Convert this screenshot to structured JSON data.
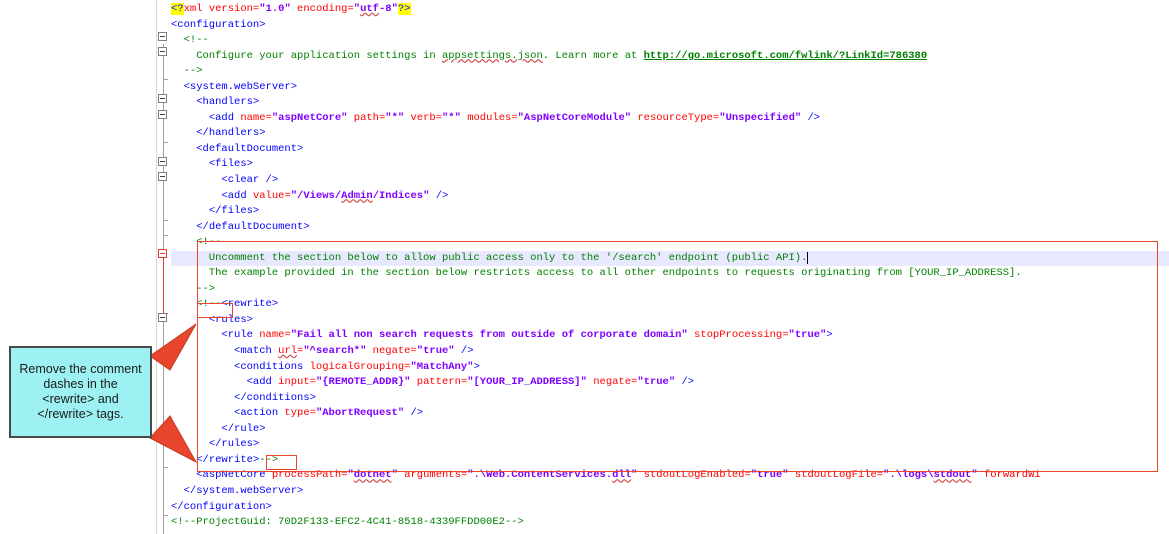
{
  "editor": {
    "lines": {
      "l1_pi_open": "<?",
      "l1_pi_name": "xml",
      "l1_attr_version": " version=",
      "l1_val_version": "\"1.0\"",
      "l1_attr_encoding": " encoding=",
      "l1_val_encoding_q1": "\"",
      "l1_val_encoding_word": "utf",
      "l1_val_encoding_rest": "-8\"",
      "l1_pi_close": "?>",
      "l2": "<configuration>",
      "l3_indent": "  ",
      "l3": "<!--",
      "l4_pre": "    Configure your application settings in ",
      "l4_sq": "appsettings.json",
      "l4_mid": ". Learn more at ",
      "l4_link": "http://go.microsoft.com/fwlink/?LinkId=786380",
      "l5": "  -->",
      "l6_indent": "  ",
      "l6": "<system.webServer>",
      "l7_indent": "    ",
      "l7": "<handlers>",
      "l8_indent": "      ",
      "l8_tag_open": "<add",
      "l8_a1": " name=",
      "l8_v1": "\"aspNetCore\"",
      "l8_a2": " path=",
      "l8_v2": "\"*\"",
      "l8_a3": " verb=",
      "l8_v3": "\"*\"",
      "l8_a4": " modules=",
      "l8_v4": "\"AspNetCoreModule\"",
      "l8_a5": " resourceType=",
      "l8_v5": "\"Unspecified\"",
      "l8_tag_close": " />",
      "l9_indent": "    ",
      "l9": "</handlers>",
      "l10_indent": "    ",
      "l10": "<defaultDocument>",
      "l11_indent": "      ",
      "l11": "<files>",
      "l12_indent": "        ",
      "l12": "<clear />",
      "l13_indent": "        ",
      "l13_tag_open": "<add",
      "l13_a1": " value=",
      "l13_v1_pre": "\"/Views/",
      "l13_v1_sq": "Admin",
      "l13_v1_post": "/Indices\"",
      "l13_tag_close": " />",
      "l14_indent": "      ",
      "l14": "</files>",
      "l15_indent": "    ",
      "l15": "</defaultDocument>",
      "l16_indent": "    ",
      "l16": "<!--",
      "l17": "      Uncomment the section below to allow public access only to the '/search' endpoint (public API).",
      "l18": "      The example provided in the section below restricts access to all other endpoints to requests originating from [YOUR_IP_ADDRESS].",
      "l19": "    -->",
      "l20_indent": "    ",
      "l20_cmt": "<!--",
      "l20_tag": "<rewrite>",
      "l21_indent": "      ",
      "l21": "<rules>",
      "l22_indent": "        ",
      "l22_tag_open": "<rule",
      "l22_a1": " name=",
      "l22_v1": "\"Fail all non search requests from outside of corporate domain\"",
      "l22_a2": " stopProcessing=",
      "l22_v2": "\"true\"",
      "l22_tag_close": ">",
      "l23_indent": "          ",
      "l23_tag_open": "<match",
      "l23_a1_sp": " ",
      "l23_a1_sq": "url",
      "l23_a1_eq": "=",
      "l23_v1": "\"^search*\"",
      "l23_a2": " negate=",
      "l23_v2": "\"true\"",
      "l23_tag_close": " />",
      "l24_indent": "          ",
      "l24_tag_open": "<conditions",
      "l24_a1": " logicalGrouping=",
      "l24_v1": "\"MatchAny\"",
      "l24_tag_close": ">",
      "l25_indent": "            ",
      "l25_tag_open": "<add",
      "l25_a1": " input=",
      "l25_v1": "\"{REMOTE_ADDR}\"",
      "l25_a2": " pattern=",
      "l25_v2": "\"[YOUR_IP_ADDRESS]\"",
      "l25_a3": " negate=",
      "l25_v3": "\"true\"",
      "l25_tag_close": " />",
      "l26_indent": "          ",
      "l26": "</conditions>",
      "l27_indent": "          ",
      "l27_tag_open": "<action",
      "l27_a1": " type=",
      "l27_v1": "\"AbortRequest\"",
      "l27_tag_close": " />",
      "l28_indent": "        ",
      "l28": "</rule>",
      "l29_indent": "      ",
      "l29": "</rules>",
      "l30_indent": "    ",
      "l30_tag": "</rewrite>",
      "l30_cmt": "-->",
      "l31_indent": "    ",
      "l31_tag_open": "<aspNetCore",
      "l31_a1": " processPath=",
      "l31_v1_q": "\"",
      "l31_v1_sq": "dotnet",
      "l31_v1_q2": "\"",
      "l31_a2": " arguments=",
      "l31_v2_pre": "\".\\Web.ContentServices.",
      "l31_v2_sq": "dll",
      "l31_v2_post": "\"",
      "l31_a3": " stdoutLogEnabled=",
      "l31_v3": "\"true\"",
      "l31_a4": " stdoutLogFile=",
      "l31_v4_pre": "\".\\logs\\",
      "l31_v4_sq": "stdout",
      "l31_v4_post": "\"",
      "l31_a5": " forwardWi",
      "l32_indent": "  ",
      "l32": "</system.webServer>",
      "l33": "</configuration>",
      "l34": "<!--ProjectGuid: 70D2F133-EFC2-4C41-8518-4339FFDD00E2-->"
    }
  },
  "callout": {
    "text": "Remove the comment dashes in the <rewrite> and </rewrite> tags."
  },
  "colors": {
    "highlight_box": "#e8452c",
    "callout_fill": "#9ef1f2",
    "comment": "#008000",
    "tag": "#0000ff",
    "attribute": "#ff0000",
    "value": "#8000ff"
  },
  "icons": [
    "fold-minus-icon",
    "callout-arrow-icon"
  ]
}
